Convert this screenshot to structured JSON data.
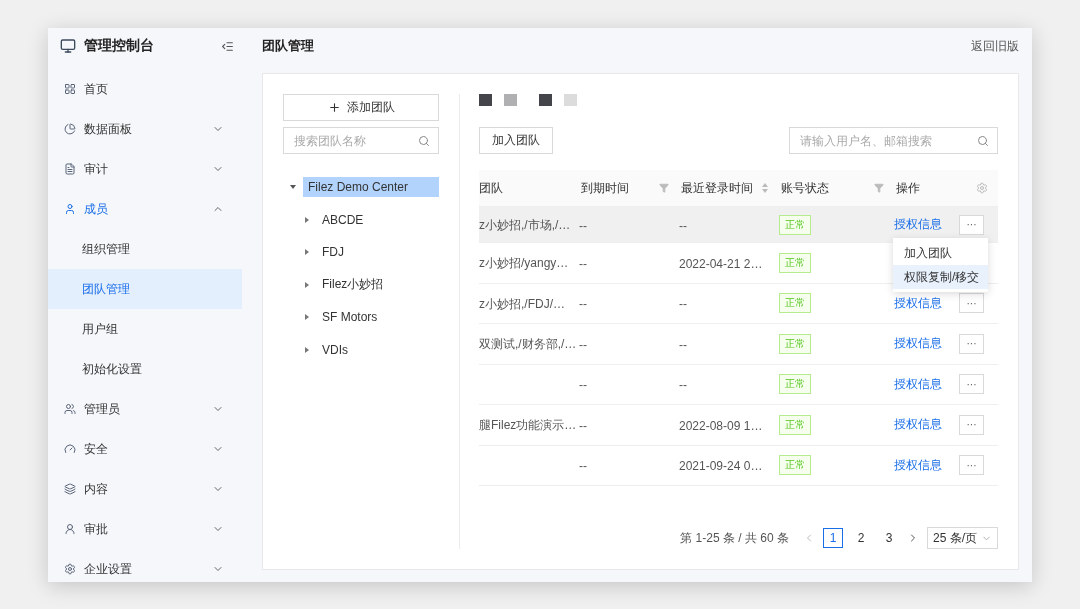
{
  "sidebar": {
    "title": "管理控制台",
    "items": [
      {
        "label": "首页"
      },
      {
        "label": "数据面板",
        "expanded": false
      },
      {
        "label": "审计",
        "expanded": false
      },
      {
        "label": "成员",
        "expanded": true,
        "children": [
          {
            "label": "组织管理",
            "selected": false
          },
          {
            "label": "团队管理",
            "selected": true
          },
          {
            "label": "用户组",
            "selected": false
          },
          {
            "label": "初始化设置",
            "selected": false
          }
        ]
      },
      {
        "label": "管理员",
        "expanded": false
      },
      {
        "label": "安全",
        "expanded": false
      },
      {
        "label": "内容",
        "expanded": false
      },
      {
        "label": "审批",
        "expanded": false
      },
      {
        "label": "企业设置",
        "expanded": false
      }
    ]
  },
  "header": {
    "title": "团队管理",
    "back_link": "返回旧版"
  },
  "tree_panel": {
    "add_button": "添加团队",
    "search_placeholder": "搜索团队名称",
    "root": {
      "label": "Filez Demo Center",
      "selected": true,
      "expanded": true,
      "children": [
        {
          "label": "ABCDE",
          "expanded": false
        },
        {
          "label": "FDJ",
          "expanded": false
        },
        {
          "label": "Filez小妙招",
          "expanded": false
        },
        {
          "label": "SF Motors",
          "expanded": false
        },
        {
          "label": "VDIs",
          "expanded": false
        }
      ]
    }
  },
  "squares": [
    {
      "color": "#44454a"
    },
    {
      "color": "#b0b0b2"
    },
    {
      "color": "#44454a"
    },
    {
      "color": "#dcdcdd"
    }
  ],
  "toolbar": {
    "join_button": "加入团队",
    "search_placeholder": "请输入用户名、邮箱搜索"
  },
  "table": {
    "columns": [
      {
        "label": "团队",
        "kind": "plain"
      },
      {
        "label": "到期时间",
        "kind": "filter"
      },
      {
        "label": "最近登录时间",
        "kind": "sort"
      },
      {
        "label": "账号状态",
        "kind": "filter"
      },
      {
        "label": "操作",
        "kind": "settings"
      }
    ],
    "rows": [
      {
        "team": "z小妙招,/市场,/…",
        "expiry": "--",
        "last_login": "--",
        "status": "正常",
        "action": "授权信息",
        "more": "···",
        "highlighted": true
      },
      {
        "team": "z小妙招/yangy…",
        "expiry": "--",
        "last_login": "2022-04-21 2…",
        "status": "正常",
        "highlighted": false
      },
      {
        "team": "z小妙招,/FDJ/…",
        "expiry": "--",
        "last_login": "--",
        "status": "正常",
        "action": "授权信息",
        "more": "···",
        "highlighted": false
      },
      {
        "team": "双测试,/财务部,/…",
        "expiry": "--",
        "last_login": "--",
        "status": "正常",
        "action": "授权信息",
        "more": "···",
        "highlighted": false
      },
      {
        "team": "",
        "expiry": "--",
        "last_login": "--",
        "status": "正常",
        "action": "授权信息",
        "more": "···",
        "highlighted": false
      },
      {
        "team": "腿Filez功能演示…",
        "expiry": "--",
        "last_login": "2022-08-09 1…",
        "status": "正常",
        "action": "授权信息",
        "more": "···",
        "highlighted": false
      },
      {
        "team": "",
        "expiry": "--",
        "last_login": "2021-09-24 0…",
        "status": "正常",
        "action": "授权信息",
        "more": "···",
        "highlighted": false
      }
    ]
  },
  "dropdown_menu": {
    "items": [
      {
        "label": "加入团队",
        "selected": false
      },
      {
        "label": "权限复制/移交",
        "selected": true
      }
    ]
  },
  "pagination": {
    "summary": "第 1-25 条 / 共 60 条",
    "pages": [
      {
        "label": "1",
        "selected": true
      },
      {
        "label": "2",
        "selected": false
      },
      {
        "label": "3",
        "selected": false
      }
    ],
    "page_size": "25 条/页"
  }
}
